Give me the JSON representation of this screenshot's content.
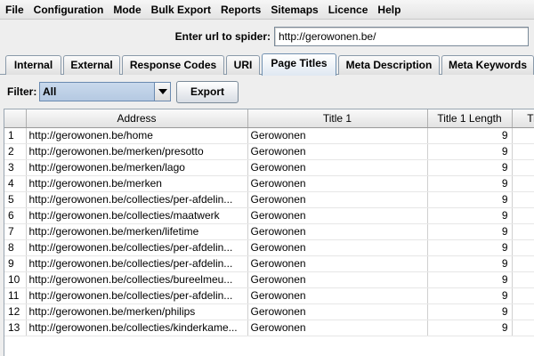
{
  "menu": [
    "File",
    "Configuration",
    "Mode",
    "Bulk Export",
    "Reports",
    "Sitemaps",
    "Licence",
    "Help"
  ],
  "url_bar": {
    "label": "Enter url to spider:",
    "value": "http://gerowonen.be/"
  },
  "tabs": [
    {
      "label": "Internal",
      "active": false
    },
    {
      "label": "External",
      "active": false
    },
    {
      "label": "Response Codes",
      "active": false
    },
    {
      "label": "URI",
      "active": false
    },
    {
      "label": "Page Titles",
      "active": true
    },
    {
      "label": "Meta Description",
      "active": false
    },
    {
      "label": "Meta Keywords",
      "active": false
    }
  ],
  "filter": {
    "label": "Filter:",
    "value": "All",
    "export_label": "Export"
  },
  "table": {
    "headers": [
      "",
      "Address",
      "Title 1",
      "Title 1 Length",
      "Titl"
    ],
    "rows": [
      [
        "1",
        "http://gerowonen.be/home",
        "Gerowonen",
        "9",
        ""
      ],
      [
        "2",
        "http://gerowonen.be/merken/presotto",
        "Gerowonen",
        "9",
        ""
      ],
      [
        "3",
        "http://gerowonen.be/merken/lago",
        "Gerowonen",
        "9",
        ""
      ],
      [
        "4",
        "http://gerowonen.be/merken",
        "Gerowonen",
        "9",
        ""
      ],
      [
        "5",
        "http://gerowonen.be/collecties/per-afdelin...",
        "Gerowonen",
        "9",
        ""
      ],
      [
        "6",
        "http://gerowonen.be/collecties/maatwerk",
        "Gerowonen",
        "9",
        ""
      ],
      [
        "7",
        "http://gerowonen.be/merken/lifetime",
        "Gerowonen",
        "9",
        ""
      ],
      [
        "8",
        "http://gerowonen.be/collecties/per-afdelin...",
        "Gerowonen",
        "9",
        ""
      ],
      [
        "9",
        "http://gerowonen.be/collecties/per-afdelin...",
        "Gerowonen",
        "9",
        ""
      ],
      [
        "10",
        "http://gerowonen.be/collecties/bureelmeu...",
        "Gerowonen",
        "9",
        ""
      ],
      [
        "11",
        "http://gerowonen.be/collecties/per-afdelin...",
        "Gerowonen",
        "9",
        ""
      ],
      [
        "12",
        "http://gerowonen.be/merken/philips",
        "Gerowonen",
        "9",
        ""
      ],
      [
        "13",
        "http://gerowonen.be/collecties/kinderkame...",
        "Gerowonen",
        "9",
        ""
      ]
    ]
  }
}
